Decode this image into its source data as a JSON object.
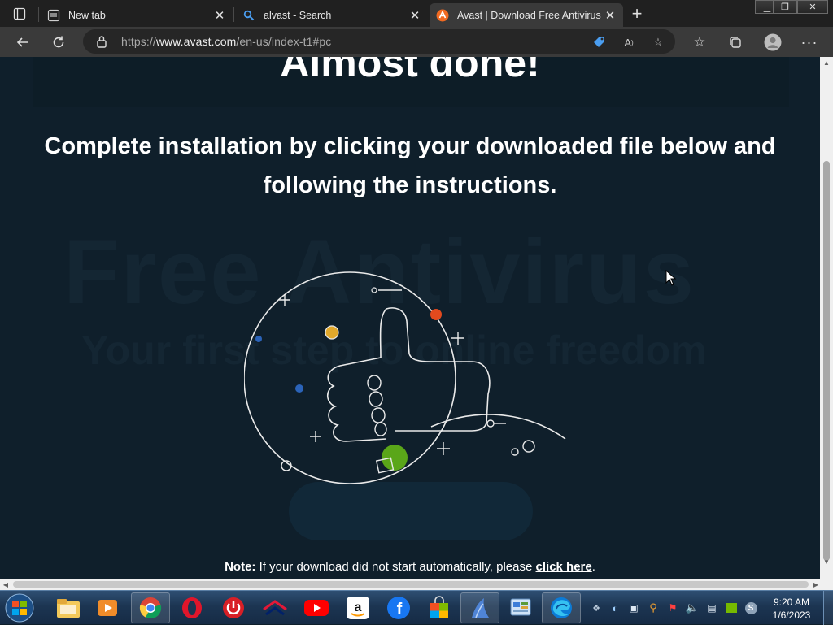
{
  "browser": {
    "tabs": [
      {
        "title": "New tab",
        "favicon": "new-tab-page-icon"
      },
      {
        "title": "alvast - Search",
        "favicon": "search-icon"
      },
      {
        "title": "Avast | Download Free Antivirus &",
        "favicon": "avast-logo-icon"
      }
    ],
    "address": {
      "prefix": "https://",
      "domain": "www.avast.com",
      "path": "/en-us/index-t1#pc"
    },
    "accent": "#2b7de9"
  },
  "page": {
    "heading": "Almost done!",
    "subheading": "Complete installation by clicking your downloaded file below and following the instructions.",
    "note_label": "Note:",
    "note_text": "If your download did not start automatically, please",
    "note_link": "click here",
    "note_end": ".",
    "background_colors": {
      "page": "#0f1f2b",
      "overlay_text": "#142633"
    },
    "background_text_1": "Free Antivirus",
    "background_text_2": "Your first step to online freedom"
  },
  "taskbar": {
    "apps": [
      "windows-explorer-icon",
      "media-player-icon",
      "chrome-icon",
      "opera-icon",
      "power-icon",
      "bank-of-america-icon",
      "youtube-icon",
      "amazon-icon",
      "facebook-icon",
      "store-bag-icon",
      "shark-icon",
      "control-panel-icon",
      "edge-icon"
    ],
    "clock": {
      "time": "9:20 AM",
      "date": "1/6/2023"
    }
  }
}
